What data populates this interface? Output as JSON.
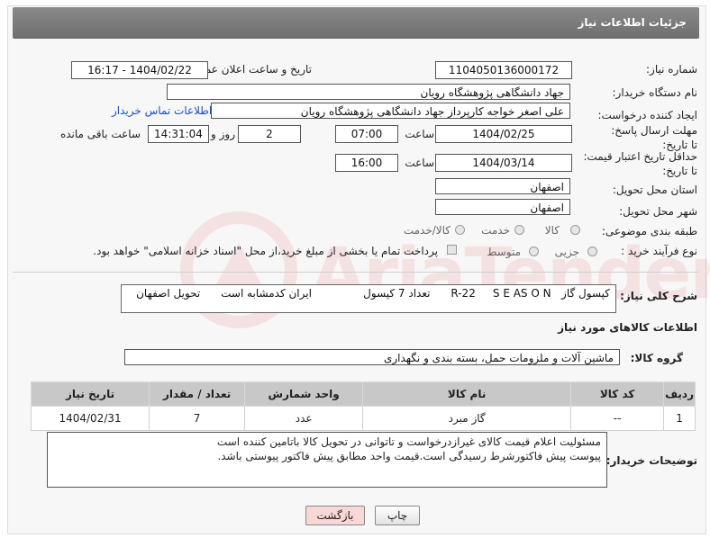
{
  "page": {
    "title": "جزئیات اطلاعات نیاز"
  },
  "form": {
    "need_number_label": "شماره نیاز:",
    "need_number": "1104050136000172",
    "announce_datetime_label": "تاریخ و ساعت اعلان عمومی:",
    "announce_datetime": "1404/02/22 - 16:17",
    "buyer_org_label": "نام دستگاه خریدار:",
    "buyer_org": "جهاد دانشگاهی پژوهشگاه رویان",
    "requester_label": "ایجاد کننده درخواست:",
    "requester": "علی اصغر خواجه کارپرداز جهاد دانشگاهی پژوهشگاه رویان",
    "buyer_contact_link": "اطلاعات تماس خریدار",
    "reply_deadline_label": "مهلت ارسال پاسخ: تا تاریخ:",
    "reply_date": "1404/02/25",
    "time_label": "ساعت",
    "reply_time": "07:00",
    "days_count": "2",
    "day_and_label": "روز و",
    "remaining_time": "14:31:04",
    "remaining_label": "ساعت باقی مانده",
    "price_validity_label": "حداقل تاریخ اعتبار قیمت: تا تاریخ:",
    "price_validity_date": "1404/03/14",
    "price_validity_time": "16:00",
    "delivery_province_label": "استان محل تحویل:",
    "delivery_province": "اصفهان",
    "delivery_city_label": "شهر محل تحویل:",
    "delivery_city": "اصفهان",
    "category_label": "طبقه بندی موضوعی:",
    "category_options": [
      "کالا",
      "خدمت",
      "کالا/خدمت"
    ],
    "category_selected": "کالا",
    "process_label": "نوع فرآیند خرید :",
    "process_options": [
      "جزیی",
      "متوسط"
    ],
    "payment_note": "پرداخت تمام یا بخشی از مبلغ خرید،از محل \"اسناد خزانه اسلامی\" خواهد بود."
  },
  "description": {
    "label": "شرح کلی نیاز:",
    "text": "کپسول گاز   R-22     S E AS O N      تعداد 7 کپسول               ایران کدمشابه است      تحویل اصفهان"
  },
  "goods_info": {
    "heading": "اطلاعات کالاهای مورد نیاز",
    "group_label": "گروه کالا:",
    "group_value": "ماشین آلات و ملزومات حمل، بسته بندی و نگهداری"
  },
  "table": {
    "headers": [
      "ردیف",
      "کد کالا",
      "نام کالا",
      "واحد شمارش",
      "تعداد / مقدار",
      "تاریخ نیاز"
    ],
    "rows": [
      [
        "1",
        "--",
        "گاز مبرد",
        "عدد",
        "7",
        "1404/02/31"
      ]
    ]
  },
  "buyer_notes": {
    "label": "توضیحات خریدار:",
    "line1": "مسئولیت اعلام قیمت کالای غیرازدرخواست و تاتوانی در تحویل کالا باتامین کننده است",
    "line2": "پیوست پیش فاکتورشرط رسیدگی است.قیمت واحد مطابق پیش فاکتور پیوستی باشد."
  },
  "buttons": {
    "print": "چاپ",
    "back": "بازگشت"
  },
  "watermark": {
    "text": "AriaTender.neT"
  },
  "colors": {
    "title_bar": "#7a7a7a",
    "link": "#1a4fc4",
    "back_button_bg": "#f8d7d7"
  }
}
